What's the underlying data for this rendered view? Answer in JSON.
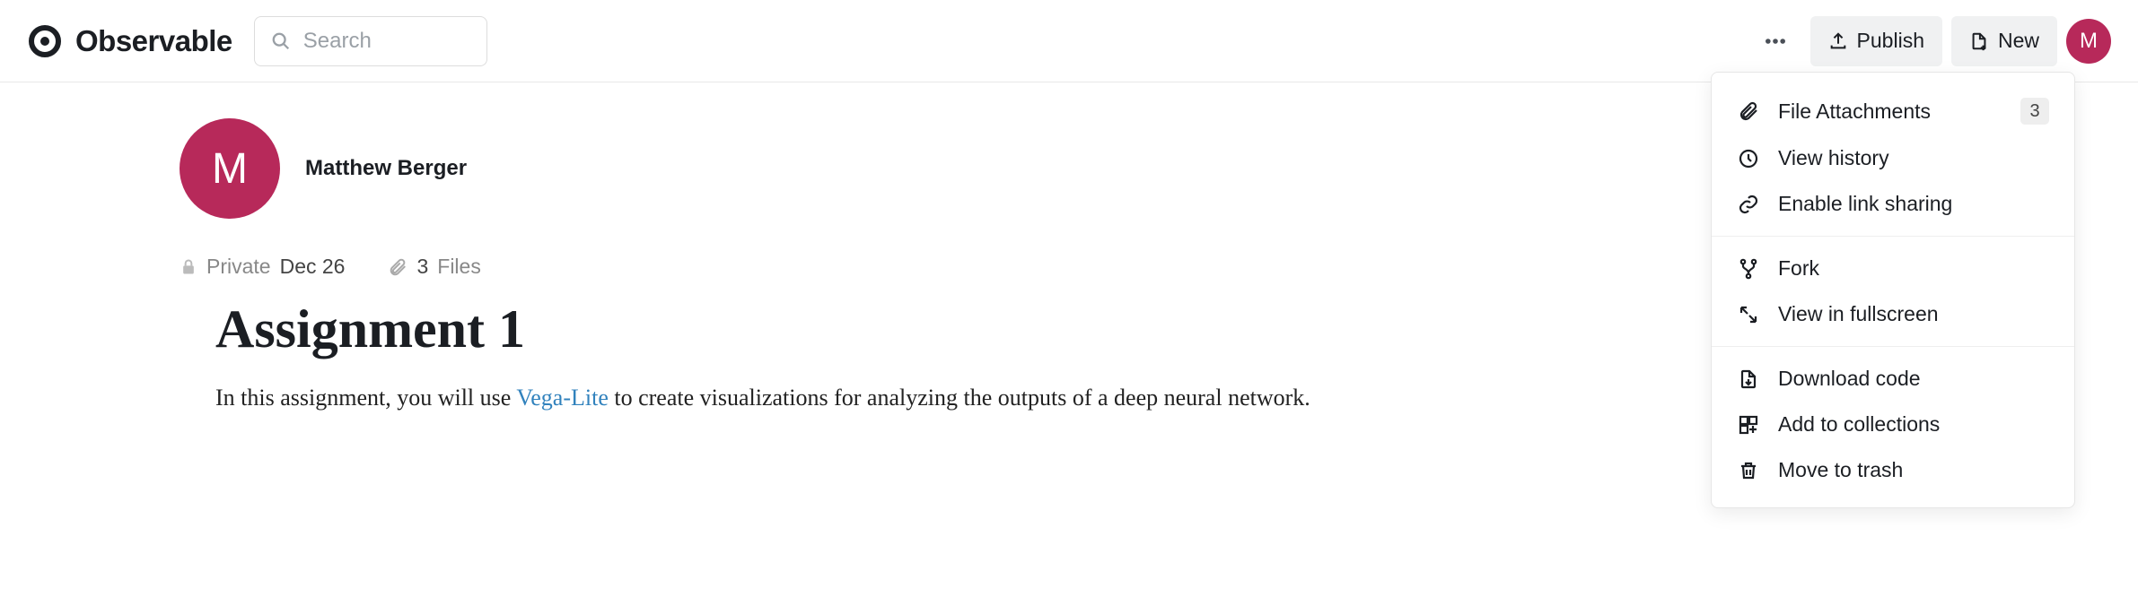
{
  "header": {
    "brand": "Observable",
    "search_placeholder": "Search",
    "publish_label": "Publish",
    "new_label": "New",
    "avatar_initial": "M"
  },
  "author": {
    "name": "Matthew Berger",
    "avatar_initial": "M"
  },
  "meta": {
    "privacy": "Private",
    "date": "Dec 26",
    "file_count": "3",
    "files_label": "Files"
  },
  "document": {
    "title": "Assignment 1",
    "body_pre": "In this assignment, you will use ",
    "link_text": "Vega-Lite",
    "body_post": " to create visualizations for analyzing the outputs of a deep neural network."
  },
  "menu": {
    "file_attachments": "File Attachments",
    "file_attachments_count": "3",
    "view_history": "View history",
    "enable_link_sharing": "Enable link sharing",
    "fork": "Fork",
    "view_fullscreen": "View in fullscreen",
    "download_code": "Download code",
    "add_to_collections": "Add to collections",
    "move_to_trash": "Move to trash"
  }
}
